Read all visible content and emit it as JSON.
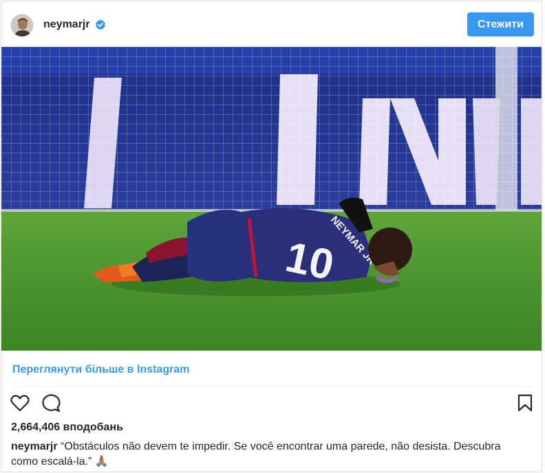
{
  "header": {
    "username": "neymarjr",
    "verified": true,
    "follow_label": "Стежити"
  },
  "photo": {
    "jersey_name": "NEYMAR JR",
    "jersey_number": "10",
    "banner_letters": "N"
  },
  "view_more_label": "Переглянути більше в Instagram",
  "actions": {
    "like_icon": "heart-outline-icon",
    "comment_icon": "speech-bubble-icon",
    "save_icon": "bookmark-icon"
  },
  "likes_label": "2,664,406 вподобань",
  "caption": {
    "username": "neymarjr",
    "text": "“Obstáculos não devem te impedir. Se você encontrar uma parede, não desista. Descubra como escalá-la.”",
    "emoji": "🙏🏽"
  },
  "colors": {
    "accent": "#3897f0",
    "text": "#262626",
    "border": "#dbdbdb"
  }
}
